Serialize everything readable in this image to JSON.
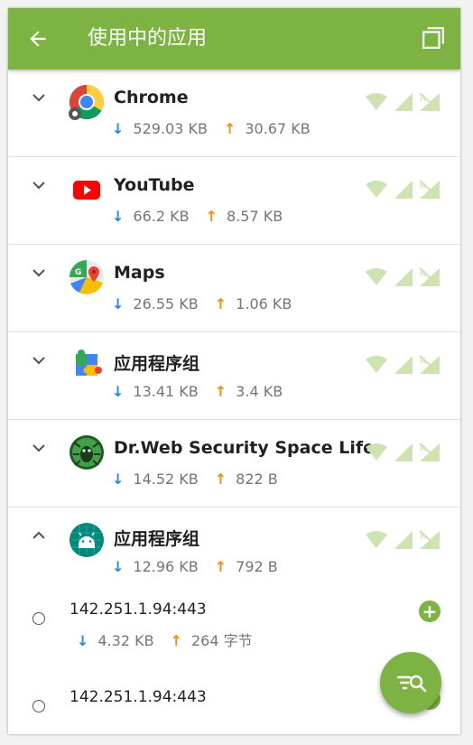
{
  "header": {
    "title": "使用中的应用",
    "back_icon": "arrow-left-icon",
    "window_icon": "window-icon"
  },
  "colors": {
    "accent": "#7cb342",
    "download": "#1e88e5",
    "upload": "#fb8c00"
  },
  "apps": [
    {
      "name": "Chrome",
      "down": "529.03 KB",
      "up": "30.67 KB",
      "icon": "chrome-icon",
      "expanded": false
    },
    {
      "name": "YouTube",
      "down": "66.2 KB",
      "up": "8.57 KB",
      "icon": "youtube-icon",
      "expanded": false
    },
    {
      "name": "Maps",
      "down": "26.55 KB",
      "up": "1.06 KB",
      "icon": "maps-icon",
      "expanded": false
    },
    {
      "name": "应用程序组",
      "down": "13.41 KB",
      "up": "3.4 KB",
      "icon": "puzzle-icon",
      "expanded": false
    },
    {
      "name": "Dr.Web Security Space Life",
      "down": "14.52 KB",
      "up": "822 B",
      "icon": "drweb-icon",
      "expanded": false
    },
    {
      "name": "应用程序组",
      "down": "12.96 KB",
      "up": "792 B",
      "icon": "android-icon",
      "expanded": true
    }
  ],
  "connections": [
    {
      "address": "142.251.1.94:443",
      "down": "4.32 KB",
      "up": "264 字节"
    },
    {
      "address": "142.251.1.94:443"
    }
  ],
  "fab": {
    "icon": "filter-search-icon"
  }
}
